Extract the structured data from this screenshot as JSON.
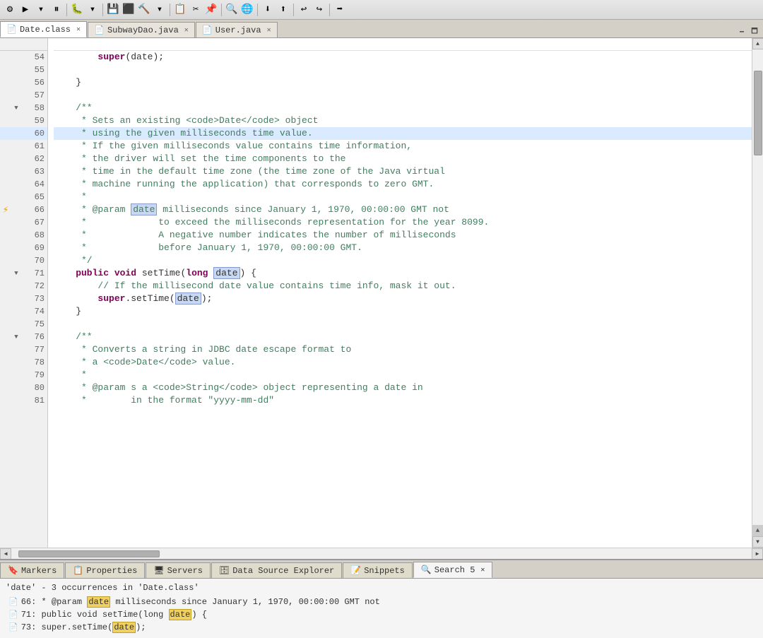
{
  "toolbar": {
    "icons": [
      "⚙",
      "▶",
      "⏸",
      "⬛",
      "🔁",
      "🐞",
      "🔨",
      "💾",
      "📋",
      "✂",
      "📌",
      "🔍",
      "🌐",
      "⬇",
      "⬆",
      "↩",
      "↪",
      "➡"
    ]
  },
  "tabs": {
    "editor_tabs": [
      {
        "id": "date-class",
        "label": "Date.class",
        "icon": "📄",
        "active": true,
        "closable": true
      },
      {
        "id": "subway-dao",
        "label": "SubwayDao.java",
        "icon": "📄",
        "active": false,
        "closable": true
      },
      {
        "id": "user-java",
        "label": "User.java",
        "icon": "📄",
        "active": false,
        "closable": true
      }
    ]
  },
  "code": {
    "lines": [
      {
        "num": 54,
        "content": "        super(date);"
      },
      {
        "num": 55,
        "content": ""
      },
      {
        "num": 56,
        "content": "    }"
      },
      {
        "num": 57,
        "content": ""
      },
      {
        "num": 58,
        "content": "    /**",
        "fold": true
      },
      {
        "num": 59,
        "content": "     * Sets an existing <code>Date</code> object"
      },
      {
        "num": 60,
        "content": "     * using the given milliseconds time value.",
        "highlighted": true
      },
      {
        "num": 61,
        "content": "     * If the given milliseconds value contains time information,"
      },
      {
        "num": 62,
        "content": "     * the driver will set the time components to the"
      },
      {
        "num": 63,
        "content": "     * time in the default time zone (the time zone of the Java virtual"
      },
      {
        "num": 64,
        "content": "     * machine running the application) that corresponds to zero GMT."
      },
      {
        "num": 65,
        "content": "     *"
      },
      {
        "num": 66,
        "content": "     * @param date milliseconds since January 1, 1970, 00:00:00 GMT not",
        "has_marker": true
      },
      {
        "num": 67,
        "content": "     *             to exceed the milliseconds representation for the year 8099."
      },
      {
        "num": 68,
        "content": "     *             A negative number indicates the number of milliseconds"
      },
      {
        "num": 69,
        "content": "     *             before January 1, 1970, 00:00:00 GMT."
      },
      {
        "num": 70,
        "content": "     */"
      },
      {
        "num": 71,
        "content": "    public void setTime(long date) {",
        "fold": true
      },
      {
        "num": 72,
        "content": "        // If the millisecond date value contains time info, mask it out."
      },
      {
        "num": 73,
        "content": "        super.setTime(date);"
      },
      {
        "num": 74,
        "content": "    }"
      },
      {
        "num": 75,
        "content": ""
      },
      {
        "num": 76,
        "content": "    /**",
        "fold": true
      },
      {
        "num": 77,
        "content": "     * Converts a string in JDBC date escape format to"
      },
      {
        "num": 78,
        "content": "     * a <code>Date</code> value."
      },
      {
        "num": 79,
        "content": "     *"
      },
      {
        "num": 80,
        "content": "     * @param s a <code>String</code> object representing a date in"
      },
      {
        "num": 81,
        "content": "     *        in the format \"yyyy-mm-dd\""
      }
    ]
  },
  "bottom_panel": {
    "tabs": [
      {
        "id": "markers",
        "label": "Markers",
        "icon": "🔖",
        "active": false
      },
      {
        "id": "properties",
        "label": "Properties",
        "icon": "📋",
        "active": false
      },
      {
        "id": "servers",
        "label": "Servers",
        "icon": "🖥",
        "active": false
      },
      {
        "id": "data-source",
        "label": "Data Source Explorer",
        "icon": "🗄",
        "active": false
      },
      {
        "id": "snippets",
        "label": "Snippets",
        "icon": "📝",
        "active": false
      },
      {
        "id": "search",
        "label": "Search",
        "icon": "🔍",
        "active": true,
        "close": true,
        "num": 5
      }
    ],
    "search": {
      "summary": "'date' - 3 occurrences in 'Date.class'",
      "results": [
        {
          "line": "66",
          "prefix": "66: * @param ",
          "match": "date",
          "suffix": " milliseconds since January 1, 1970, 00:00:00 GMT not",
          "icon": "📄"
        },
        {
          "line": "71",
          "prefix": "71: public void setTime(long ",
          "match": "date",
          "suffix": ") {",
          "icon": "📄"
        },
        {
          "line": "73",
          "prefix": "73: super.setTime(",
          "match": "date",
          "suffix": ");",
          "icon": "📄"
        }
      ]
    }
  }
}
